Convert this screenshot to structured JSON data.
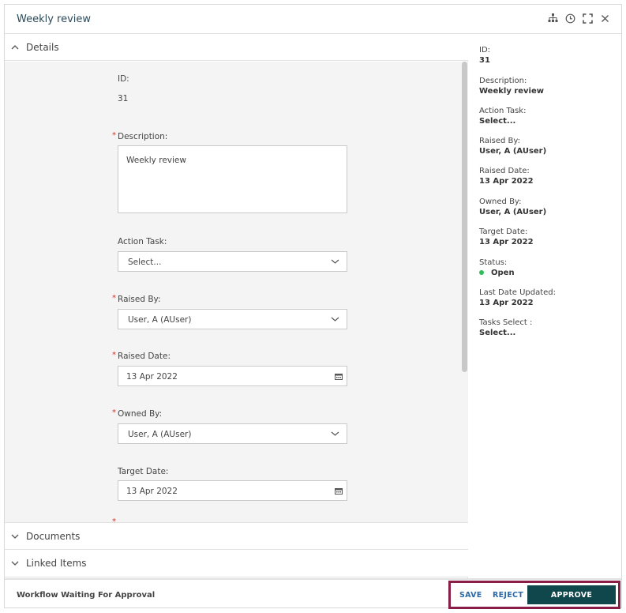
{
  "header": {
    "title": "Weekly review",
    "icons": [
      "hierarchy-icon",
      "history-icon",
      "expand-icon",
      "close-icon"
    ]
  },
  "accordion": {
    "details": "Details",
    "documents": "Documents",
    "linked_items": "Linked Items"
  },
  "form": {
    "id_label": "ID:",
    "id_value": "31",
    "description_label": "Description:",
    "description_value": "Weekly review",
    "action_task_label": "Action Task:",
    "action_task_value": "Select...",
    "raised_by_label": "Raised By:",
    "raised_by_value": "User, A (AUser)",
    "raised_date_label": "Raised Date:",
    "raised_date_value": "13 Apr 2022",
    "owned_by_label": "Owned By:",
    "owned_by_value": "User, A (AUser)",
    "target_date_label": "Target Date:",
    "target_date_value": "13 Apr 2022",
    "required_mark": "*"
  },
  "summary": [
    {
      "label": "ID:",
      "value": "31"
    },
    {
      "label": "Description:",
      "value": "Weekly review"
    },
    {
      "label": "Action Task:",
      "value": "Select..."
    },
    {
      "label": "Raised By:",
      "value": "User, A (AUser)"
    },
    {
      "label": "Raised Date:",
      "value": "13 Apr 2022"
    },
    {
      "label": "Owned By:",
      "value": "User, A (AUser)"
    },
    {
      "label": "Target Date:",
      "value": "13 Apr 2022"
    },
    {
      "label": "Status:",
      "value": "Open"
    },
    {
      "label": "Last Date Updated:",
      "value": "13 Apr 2022"
    },
    {
      "label": "Tasks Select :",
      "value": "Select..."
    }
  ],
  "colors": {
    "status_open": "#2ebd59",
    "approve_bg": "#10474c",
    "highlight_border": "#8b1e46",
    "link": "#2b6aa8"
  },
  "footer": {
    "status_text": "Workflow Waiting For Approval",
    "save": "SAVE",
    "reject": "REJECT",
    "approve": "APPROVE"
  }
}
